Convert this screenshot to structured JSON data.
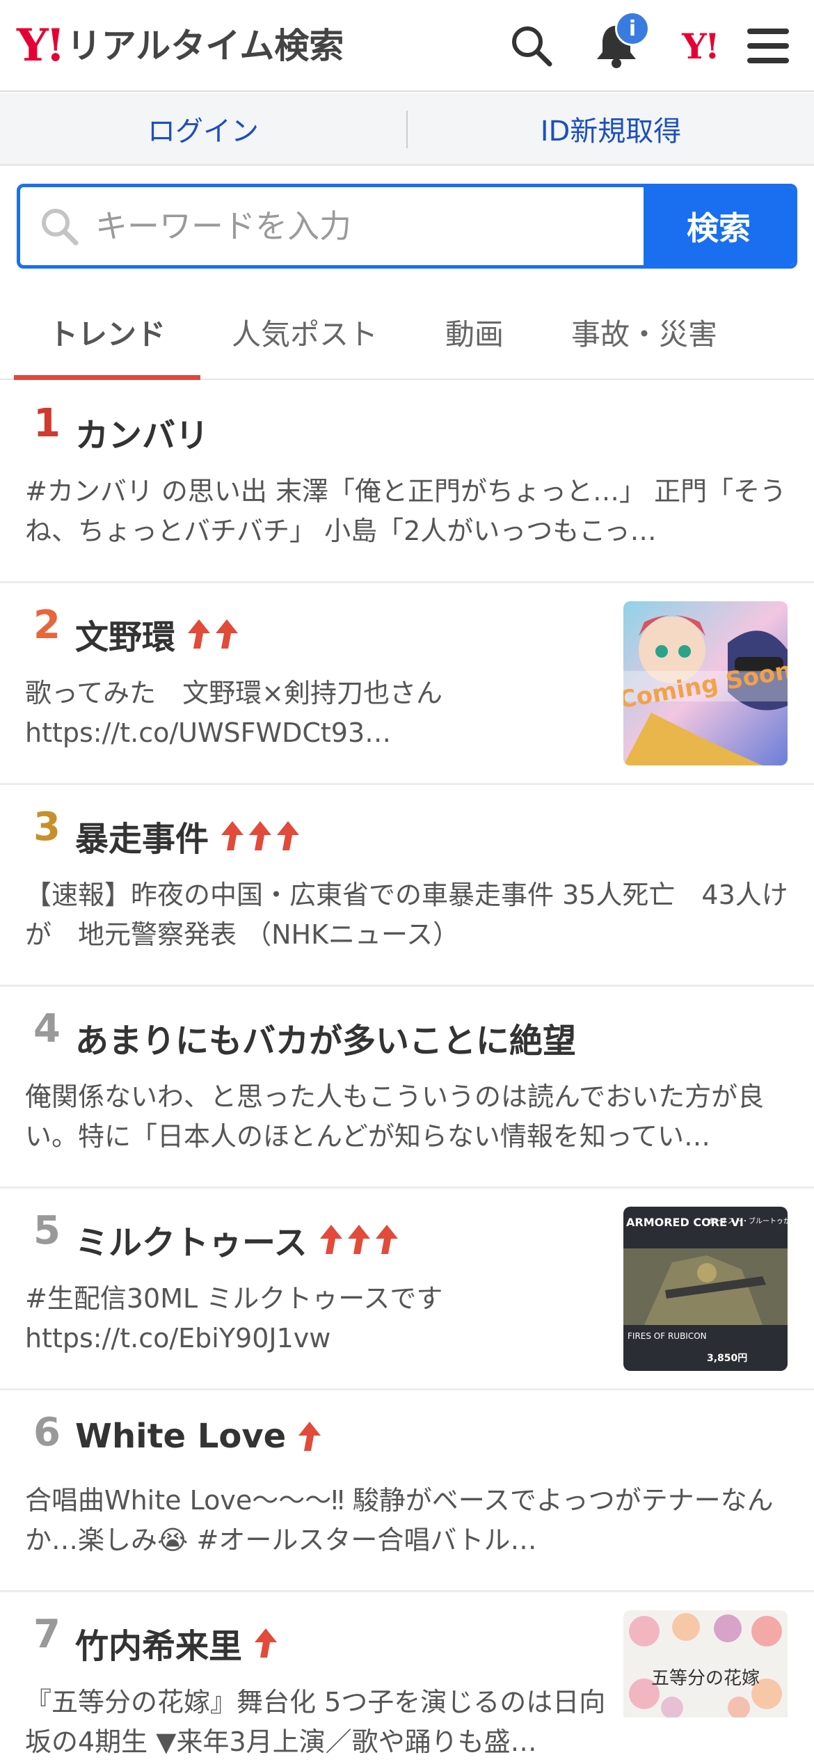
{
  "header": {
    "logo_mark": "Y!",
    "logo_text": "リアルタイム検索",
    "notification_badge": "i",
    "yahoo_mini": "Y!"
  },
  "loginbar": {
    "login": "ログイン",
    "signup": "ID新規取得"
  },
  "search": {
    "placeholder": "キーワードを入力",
    "button": "検索"
  },
  "tabs": [
    {
      "label": "トレンド",
      "active": true
    },
    {
      "label": "人気ポスト",
      "active": false
    },
    {
      "label": "動画",
      "active": false
    },
    {
      "label": "事故・災害",
      "active": false
    }
  ],
  "colors": {
    "brand_red": "#e60033",
    "accent_blue": "#1a6ff0",
    "tab_underline": "#e0473a",
    "rank1": "#d13a2f",
    "rank2": "#e8663a",
    "rank3": "#c8902a",
    "rank_other": "#999999",
    "trend_arrow": "#e24a3a"
  },
  "trends": [
    {
      "rank": "1",
      "title": "カンバリ",
      "arrows": 0,
      "thumb": null,
      "snippet": "#カンバリ の思い出 末澤「俺と正門がちょっと…」 正門「そうね、ちょっとバチバチ」 小島「2人がいっつもこっ…"
    },
    {
      "rank": "2",
      "title": "文野環",
      "arrows": 2,
      "thumb": "vtuber-art",
      "snippet": "歌ってみた　文野環×剣持刀也さん https://t.co/UWSFWDCt93…"
    },
    {
      "rank": "3",
      "title": "暴走事件",
      "arrows": 3,
      "thumb": null,
      "snippet": "【速報】昨夜の中国・広東省での車暴走事件 35人死亡　43人けが　地元警察発表 （NHKニュース）"
    },
    {
      "rank": "4",
      "title": "あまりにもバカが多いことに絶望",
      "arrows": 0,
      "thumb": null,
      "snippet": "俺関係ないわ、と思った人もこういうのは読んでおいた方が良い。特に「日本人のほとんどが知らない情報を知ってい…"
    },
    {
      "rank": "5",
      "title": "ミルクトゥース",
      "arrows": 3,
      "thumb": "mecha-ad",
      "snippet": "#生配信30ML ミルクトゥースです https://t.co/EbiY90J1vw"
    },
    {
      "rank": "6",
      "title": "White Love",
      "arrows": 1,
      "thumb": null,
      "snippet": "合唱曲White Love〜〜〜‼︎ 駿静がベースでよっつがテナーなんか…楽しみ😭 #オールスター合唱バトル…"
    },
    {
      "rank": "7",
      "title": "竹内希来里",
      "arrows": 1,
      "thumb": "stage-poster",
      "snippet": "『五等分の花嫁』舞台化 5つ子を演じるのは日向坂の4期生 ▼来年3月上演／歌や踊りも盛…"
    }
  ],
  "thumbs": {
    "vtuber_caption": "Coming Soon",
    "mecha_title": "ARMORED CORE VI",
    "mecha_sub": "FIRES OF RUBICON",
    "mecha_promo": "オーネスト・ブルートゥが贈る ミルクトゥース “お待ちしています",
    "mecha_price": "3,850円",
    "stage_title": "五等分の花嫁"
  }
}
